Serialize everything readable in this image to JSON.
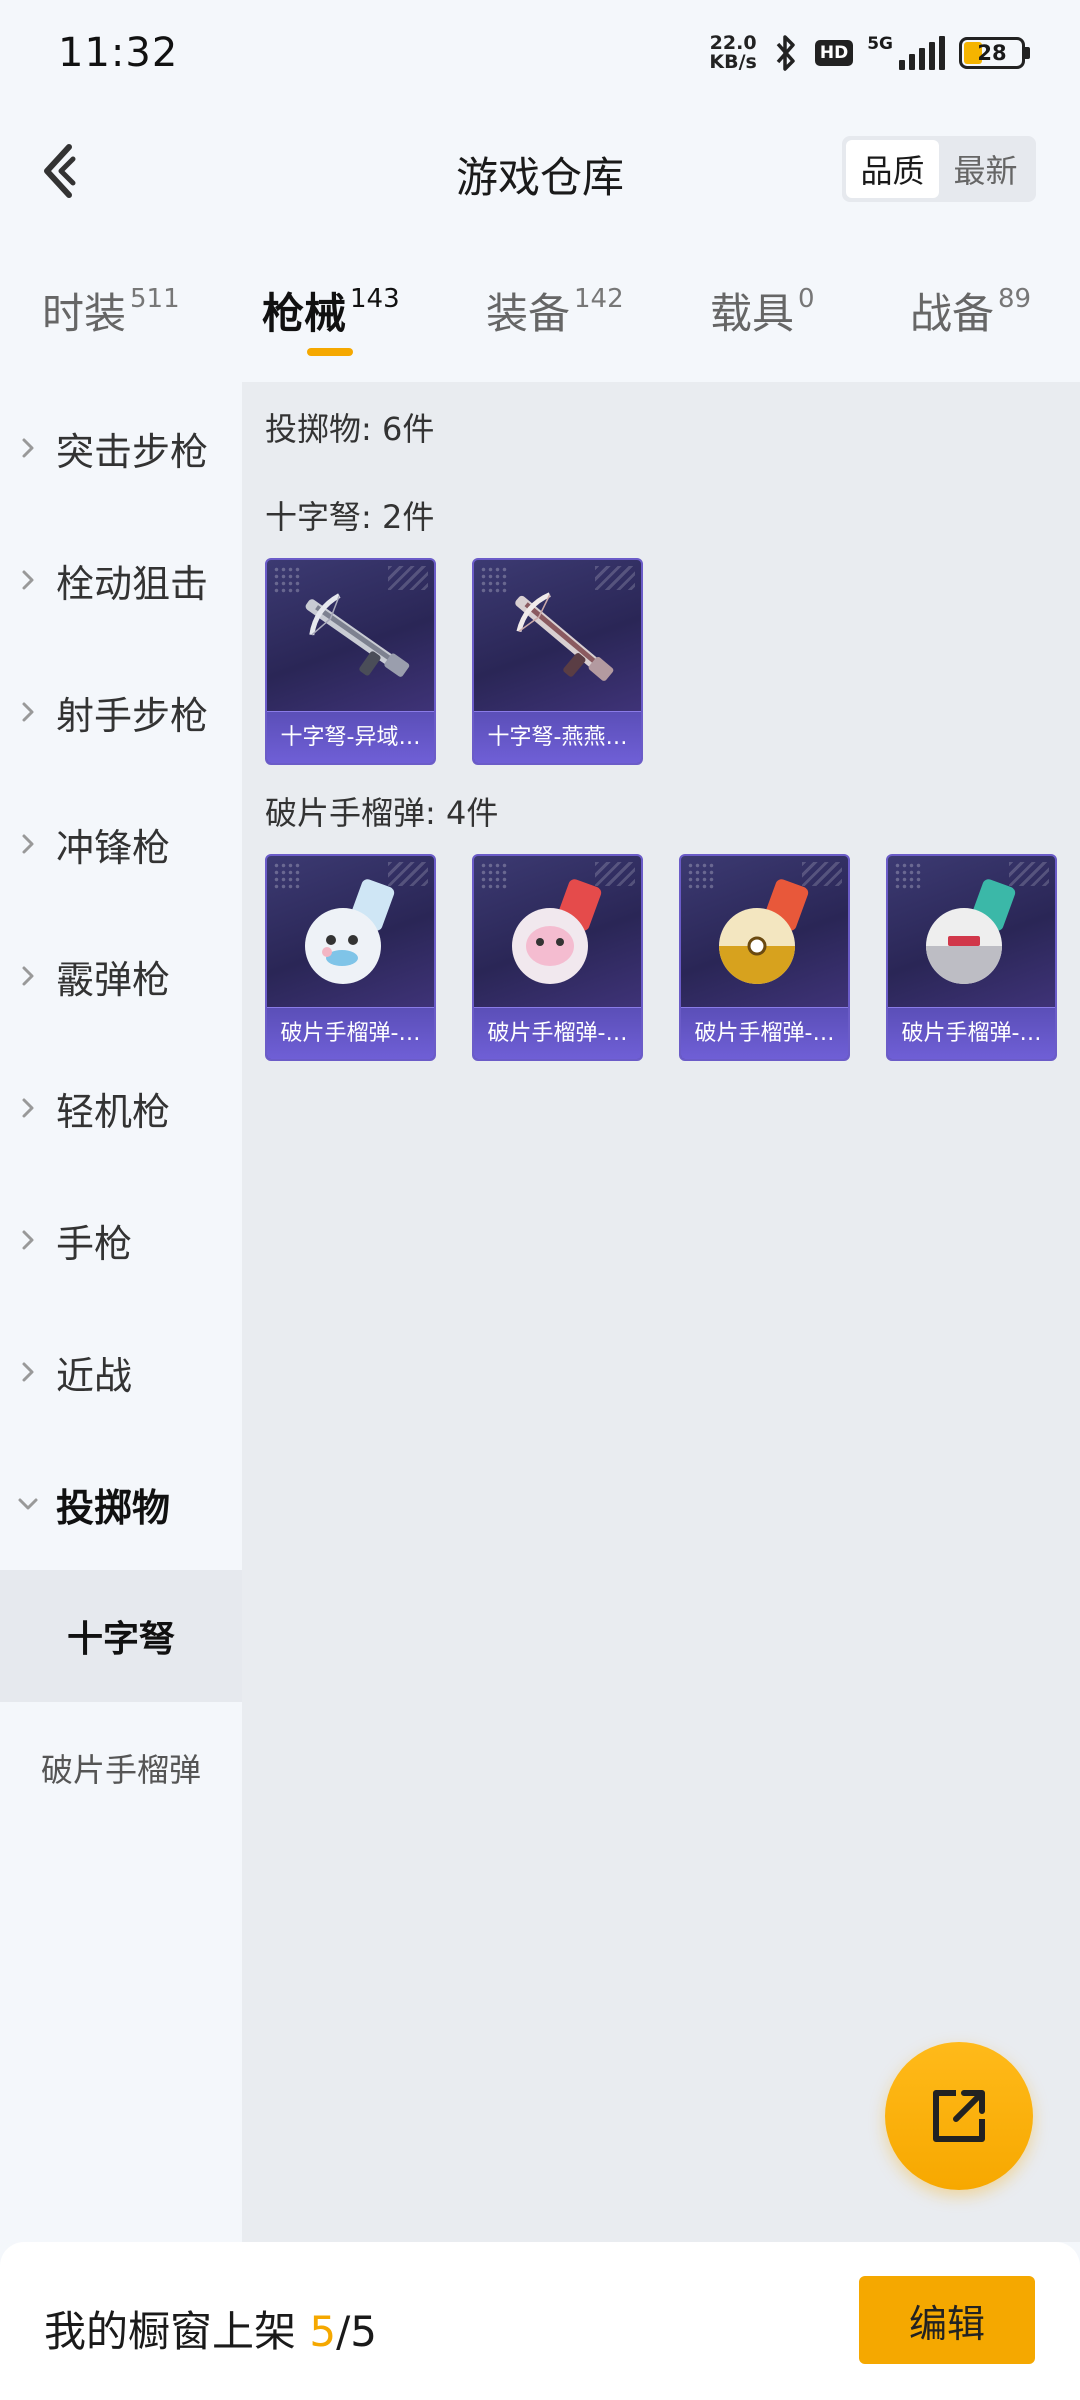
{
  "status_bar": {
    "time": "11:32",
    "net_speed_value": "22.0",
    "net_speed_unit": "KB/s",
    "hd_badge": "HD",
    "signal_label": "5G",
    "battery_level": "28"
  },
  "header": {
    "title": "游戏仓库",
    "sort_options": [
      "品质",
      "最新"
    ],
    "sort_selected": "品质"
  },
  "tabs": [
    {
      "label": "时装",
      "count": "511"
    },
    {
      "label": "枪械",
      "count": "143"
    },
    {
      "label": "装备",
      "count": "142"
    },
    {
      "label": "载具",
      "count": "0"
    },
    {
      "label": "战备",
      "count": "89"
    }
  ],
  "active_tab": "枪械",
  "sidebar": {
    "categories": [
      "突击步枪",
      "栓动狙击",
      "射手步枪",
      "冲锋枪",
      "霰弹枪",
      "轻机枪",
      "手枪",
      "近战",
      "投掷物"
    ],
    "expanded": "投掷物",
    "subcategories": [
      "十字弩",
      "破片手榴弹"
    ],
    "subcategory_selected": "十字弩"
  },
  "content": {
    "group_title": "投掷物: 6件",
    "sections": [
      {
        "title": "十字弩: 2件",
        "items": [
          {
            "name": "十字弩-异域…",
            "icon": "crossbow-icon"
          },
          {
            "name": "十字弩-燕燕…",
            "icon": "crossbow-icon"
          }
        ]
      },
      {
        "title": "破片手榴弹: 4件",
        "items": [
          {
            "name": "破片手榴弹-…",
            "icon": "grenade-icon"
          },
          {
            "name": "破片手榴弹-…",
            "icon": "grenade-icon"
          },
          {
            "name": "破片手榴弹-…",
            "icon": "grenade-icon"
          },
          {
            "name": "破片手榴弹-…",
            "icon": "grenade-icon"
          }
        ]
      }
    ]
  },
  "fab": {
    "icon": "share-external-icon"
  },
  "bottom_bar": {
    "shelf_label": "我的橱窗上架",
    "shelf_used": "5",
    "shelf_total": "/5",
    "edit_label": "编辑"
  },
  "colors": {
    "accent": "#f5a800",
    "card_purple": "#2a2656",
    "background": "#f4f7fb",
    "content_bg": "#e9ecf0"
  }
}
